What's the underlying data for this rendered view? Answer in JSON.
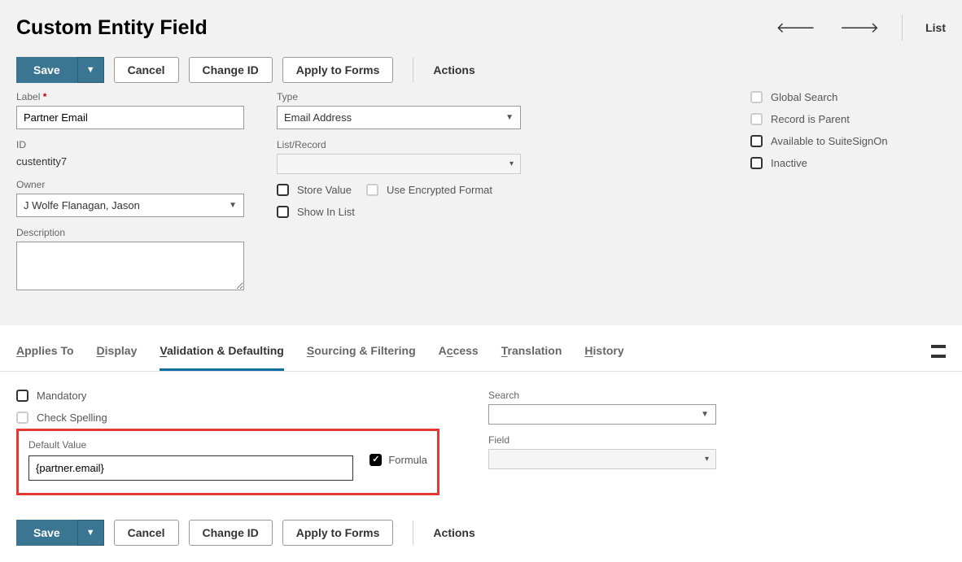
{
  "header": {
    "title": "Custom Entity Field",
    "list_link": "List"
  },
  "buttons": {
    "save": "Save",
    "cancel": "Cancel",
    "change_id": "Change ID",
    "apply": "Apply to Forms",
    "actions": "Actions"
  },
  "form": {
    "label_field": {
      "label": "Label",
      "value": "Partner Email"
    },
    "id_field": {
      "label": "ID",
      "value": "custentity7"
    },
    "owner_field": {
      "label": "Owner",
      "value": "J Wolfe Flanagan, Jason"
    },
    "description_field": {
      "label": "Description",
      "value": ""
    },
    "type_field": {
      "label": "Type",
      "value": "Email Address"
    },
    "list_record_field": {
      "label": "List/Record",
      "value": ""
    },
    "store_value": {
      "label": "Store Value"
    },
    "use_encrypted": {
      "label": "Use Encrypted Format"
    },
    "show_in_list": {
      "label": "Show In List"
    },
    "global_search": {
      "label": "Global Search"
    },
    "record_is_parent": {
      "label": "Record is Parent"
    },
    "suitesignon": {
      "label": "Available to SuiteSignOn"
    },
    "inactive": {
      "label": "Inactive"
    }
  },
  "tabs": {
    "applies_to": "Applies To",
    "display": "Display",
    "validation": "Validation & Defaulting",
    "sourcing": "Sourcing & Filtering",
    "access": "Access",
    "translation": "Translation",
    "history": "History"
  },
  "tab_body": {
    "mandatory": {
      "label": "Mandatory"
    },
    "check_spelling": {
      "label": "Check Spelling"
    },
    "default_value": {
      "label": "Default Value",
      "value": "{partner.email}"
    },
    "formula": {
      "label": "Formula"
    },
    "search": {
      "label": "Search",
      "value": ""
    },
    "field": {
      "label": "Field",
      "value": ""
    }
  }
}
